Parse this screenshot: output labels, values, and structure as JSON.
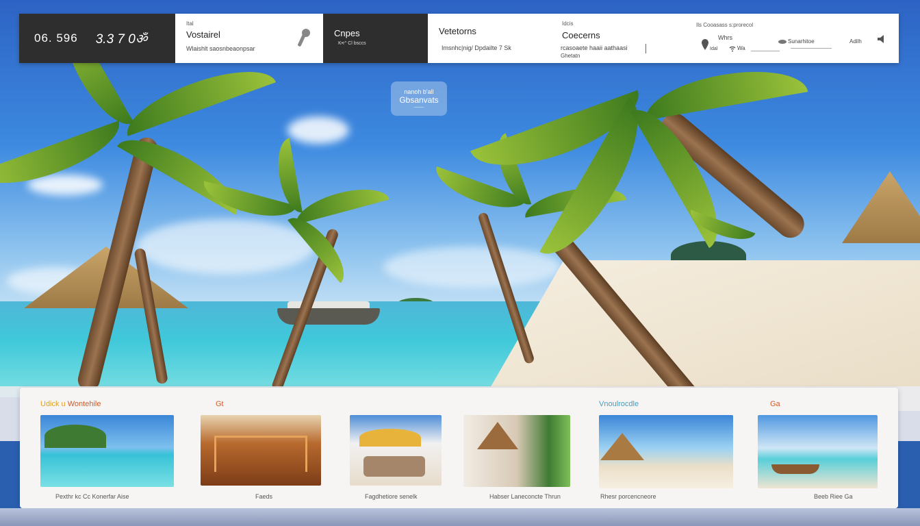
{
  "topbar": {
    "clock_primary": "06. 596",
    "clock_secondary": "3.3 7 0ॐ",
    "panel1": {
      "small": "Ital",
      "title": "Vostairel",
      "sub": "Wlaishlt  saosnbeaonpsar"
    },
    "panel2": {
      "title": "Cnpes",
      "sub": "K•r°  Cl bsccs"
    },
    "panel3": {
      "col1_title": "Vetetorns",
      "col1_sub": "Imsnhc|nig/  Dpdailte 7 Sk",
      "col2_small": "Idcis",
      "col2_title": "Coecerns",
      "col2_sub1": "rcasoaete  haaii aathaasi",
      "col2_sub2": "Ghetatn",
      "col3_small": "Ils  Cooasass  s:prorecol",
      "col3_a": "Whrs",
      "col3_a2": "Idal",
      "col3_b": "Wa",
      "col3_c": "Sunarhitoe",
      "col3_d": "Adilh"
    }
  },
  "badge": {
    "line1": "nanoh b'all",
    "line2": "Gbsanvats",
    "line3": "——"
  },
  "gallery": {
    "headings": [
      {
        "text1": "Udick  u",
        "text2": "Wontehile",
        "color1": "#e0a020",
        "color2": "#d05a2a"
      },
      {
        "text1": "Gt",
        "color1": "#d05a2a"
      },
      {
        "text1": "Vnoulrocdle",
        "color1": "#3aa0c8"
      },
      {
        "text1": "Ga",
        "color1": "#d05a2a"
      }
    ],
    "captions": [
      "Pexthr kc Cc Konerfar Aise",
      "Faeds",
      "Fagdhetiore senelk",
      "Habser Laneconcte Thrun",
      "Rhesr porcencneore",
      "Beeb Riee    Ga"
    ]
  },
  "colors": {
    "dark_panel": "#2e2e2e",
    "accent_orange": "#d05a2a",
    "accent_yellow": "#e0a020",
    "accent_blue": "#3aa0c8"
  },
  "icons": [
    "wrench-icon",
    "settings-icon",
    "location-icon",
    "wifi-icon",
    "cloud-icon",
    "speaker-icon"
  ]
}
